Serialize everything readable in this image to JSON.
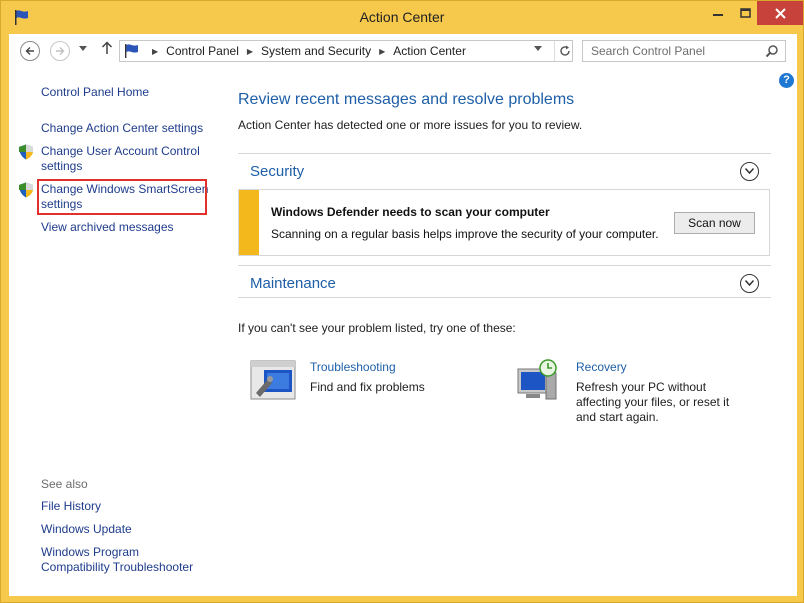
{
  "window": {
    "title": "Action Center"
  },
  "nav": {
    "breadcrumbs": [
      "Control Panel",
      "System and Security",
      "Action Center"
    ],
    "search_placeholder": "Search Control Panel"
  },
  "sidebar": {
    "home": "Control Panel Home",
    "links": [
      "Change Action Center settings",
      "Change User Account Control settings",
      "Change Windows SmartScreen settings",
      "View archived messages"
    ],
    "see_also_label": "See also",
    "see_also": [
      "File History",
      "Windows Update",
      "Windows Program Compatibility Troubleshooter"
    ]
  },
  "main": {
    "title": "Review recent messages and resolve problems",
    "subtitle": "Action Center has detected one or more issues for you to review.",
    "security": {
      "title": "Security",
      "alert_title": "Windows Defender needs to scan your computer",
      "alert_text": "Scanning on a regular basis helps improve the security of your computer.",
      "button": "Scan now"
    },
    "maintenance": {
      "title": "Maintenance"
    },
    "hint": "If you can't see your problem listed, try one of these:",
    "troubleshooting": {
      "title": "Troubleshooting",
      "desc": "Find and fix problems"
    },
    "recovery": {
      "title": "Recovery",
      "desc": "Refresh your PC without affecting your files, or reset it and start again."
    }
  },
  "colors": {
    "frame": "#f6c84c",
    "link": "#1e3c8c",
    "heading": "#1e5fa8",
    "alert_bar": "#f2b81c",
    "highlight": "#e0312d"
  }
}
